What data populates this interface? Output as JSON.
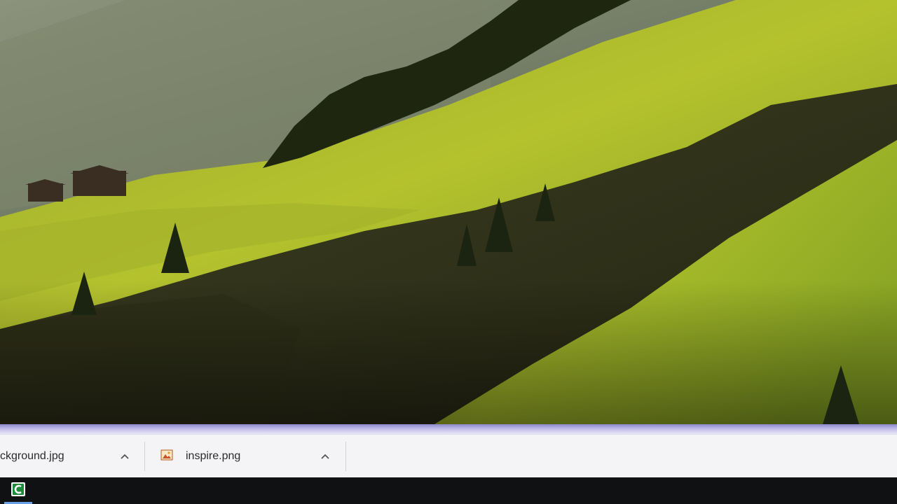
{
  "downloads_shelf": {
    "items": [
      {
        "filename": "ckground.jpg",
        "icon": "image-file-icon"
      },
      {
        "filename": "inspire.png",
        "icon": "image-file-icon"
      }
    ],
    "chevron_icon": "chevron-up-icon"
  },
  "taskbar": {
    "pinned_app_icon": "camtasia-app-icon",
    "accent_color": "#6aa0e6"
  },
  "colors": {
    "shelf_background": "#f4f4f6",
    "shelf_accent": "#b9b5e6",
    "taskbar_background": "#101112"
  }
}
